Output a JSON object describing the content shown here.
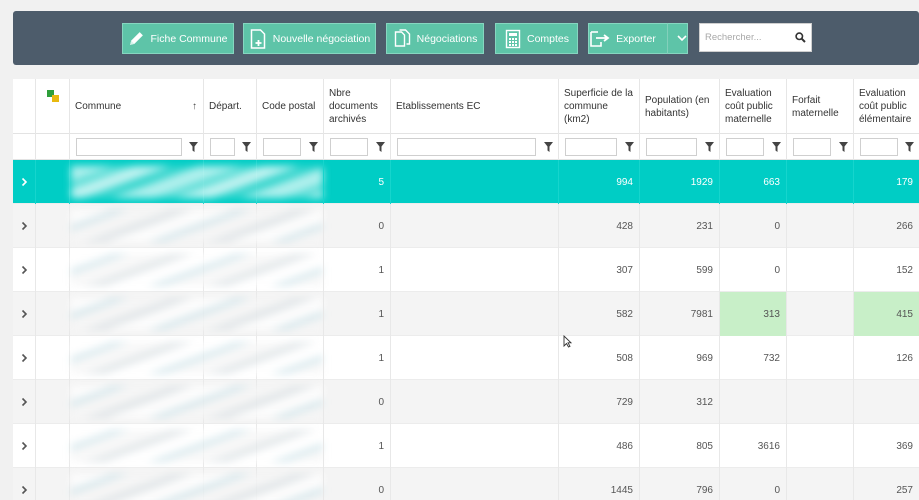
{
  "toolbar": {
    "buttons": [
      {
        "label": "Fiche Commune",
        "icon": "pencil-icon"
      },
      {
        "label": "Nouvelle négociation",
        "icon": "new-document-icon"
      },
      {
        "label": "Négociations",
        "icon": "documents-icon"
      },
      {
        "label": "Comptes",
        "icon": "calculator-icon"
      },
      {
        "label": "Exporter",
        "icon": "export-icon"
      }
    ],
    "search": {
      "placeholder": "Rechercher..."
    }
  },
  "grid": {
    "columns": [
      {
        "label": "",
        "key": "expand"
      },
      {
        "label": "",
        "key": "status-icon"
      },
      {
        "label": "Commune",
        "key": "commune"
      },
      {
        "label": "Départ.",
        "key": "depart"
      },
      {
        "label": "Code postal",
        "key": "code_postal"
      },
      {
        "label": "Nbre documents archivés",
        "key": "nbre_docs"
      },
      {
        "label": "Etablissements EC",
        "key": "etablissements"
      },
      {
        "label": "Superficie de la commune (km2)",
        "key": "superficie"
      },
      {
        "label": "Population (en habitants)",
        "key": "population"
      },
      {
        "label": "Evaluation coût public maternelle",
        "key": "eval_mat"
      },
      {
        "label": "Forfait maternelle",
        "key": "forfait_mat"
      },
      {
        "label": "Evaluation coût public élémentaire",
        "key": "eval_elem"
      }
    ],
    "sort_indicator": "↑",
    "rows": [
      {
        "selected": true,
        "nbre_docs": "5",
        "superficie": "994",
        "population": "1929",
        "eval_mat": "663",
        "eval_elem": "179",
        "green": []
      },
      {
        "selected": false,
        "nbre_docs": "0",
        "superficie": "428",
        "population": "231",
        "eval_mat": "0",
        "eval_elem": "266",
        "green": []
      },
      {
        "selected": false,
        "nbre_docs": "1",
        "superficie": "307",
        "population": "599",
        "eval_mat": "0",
        "eval_elem": "152",
        "green": []
      },
      {
        "selected": false,
        "nbre_docs": "1",
        "superficie": "582",
        "population": "7981",
        "eval_mat": "313",
        "eval_elem": "415",
        "green": [
          "eval_mat",
          "eval_elem"
        ]
      },
      {
        "selected": false,
        "nbre_docs": "1",
        "superficie": "508",
        "population": "969",
        "eval_mat": "732",
        "eval_elem": "126",
        "green": []
      },
      {
        "selected": false,
        "nbre_docs": "0",
        "superficie": "729",
        "population": "312",
        "eval_mat": "",
        "eval_elem": "",
        "green": []
      },
      {
        "selected": false,
        "nbre_docs": "1",
        "superficie": "486",
        "population": "805",
        "eval_mat": "3616",
        "eval_elem": "369",
        "green": []
      },
      {
        "selected": false,
        "nbre_docs": "0",
        "superficie": "1445",
        "population": "796",
        "eval_mat": "0",
        "eval_elem": "257",
        "green": []
      }
    ]
  },
  "colors": {
    "toolbar_bg": "#4d5c6b",
    "button_bg": "#5ec4a8",
    "selected_row": "#00cdc5",
    "highlight_cell": "#c8efc8"
  }
}
